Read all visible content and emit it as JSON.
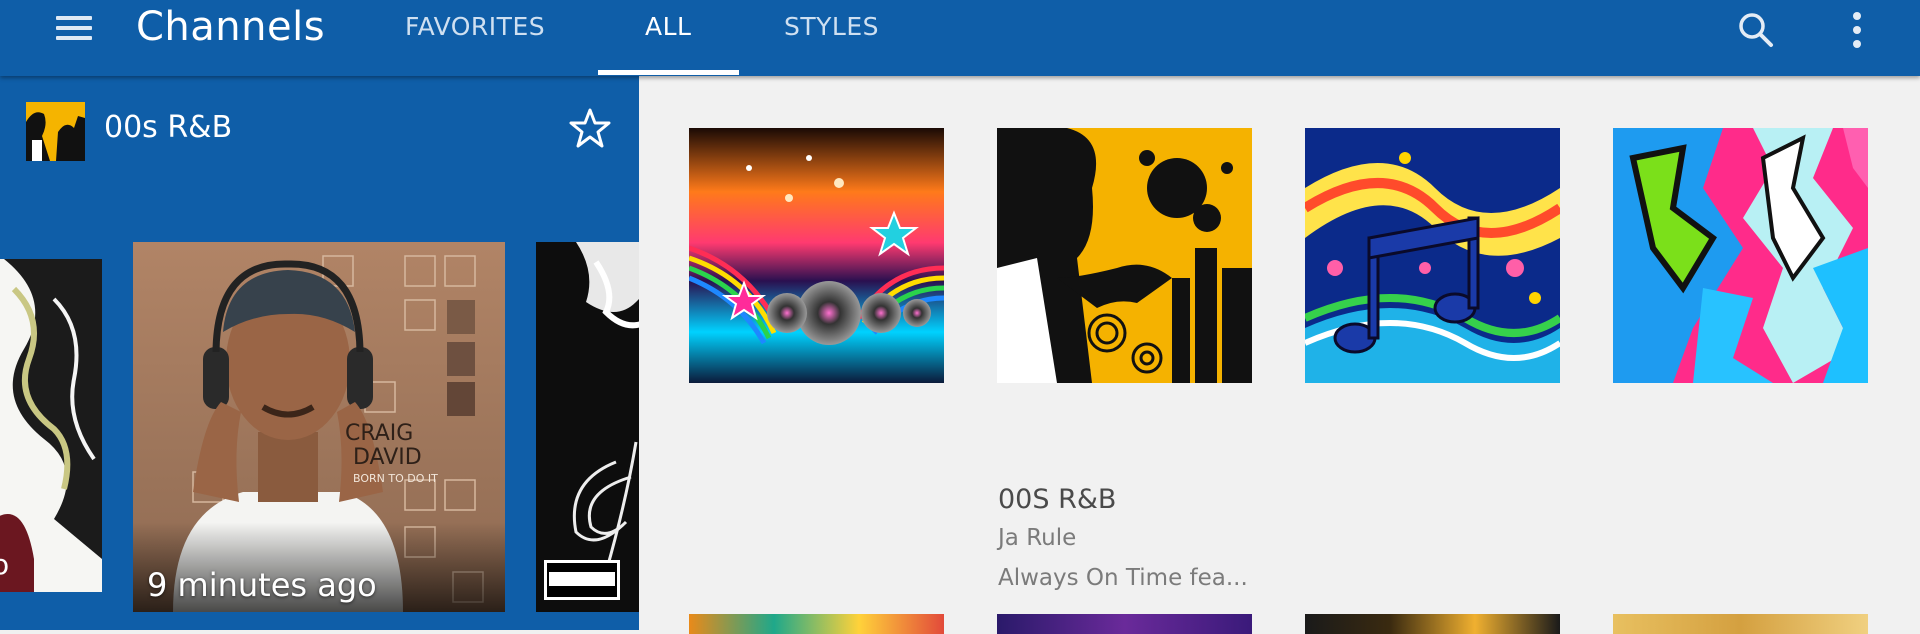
{
  "appbar": {
    "title": "Channels",
    "tabs": [
      {
        "label": "FAVORITES",
        "active": false
      },
      {
        "label": "ALL",
        "active": true
      },
      {
        "label": "STYLES",
        "active": false
      }
    ],
    "icons": [
      "menu-icon",
      "search-icon",
      "more-vert-icon"
    ]
  },
  "now_playing": {
    "channel": "00s R&B",
    "last_played": "9 minutes ago",
    "covers": [
      {
        "text": "CRAIG\nDAVID",
        "subtitle": "BORN TO DO IT"
      },
      {
        "badge": "PARENTAL ADVISORY\nEXPLICIT CONTENT"
      }
    ]
  },
  "channel_grid": {
    "featured": {
      "name": "00S R&B",
      "artist": "Ja Rule",
      "song": "Always On Time fea..."
    }
  },
  "colors": {
    "primary": "#0f5ea8",
    "background": "#f1f1f1",
    "text_dark": "#4a4a4a",
    "text_muted": "#7b7b7b"
  }
}
